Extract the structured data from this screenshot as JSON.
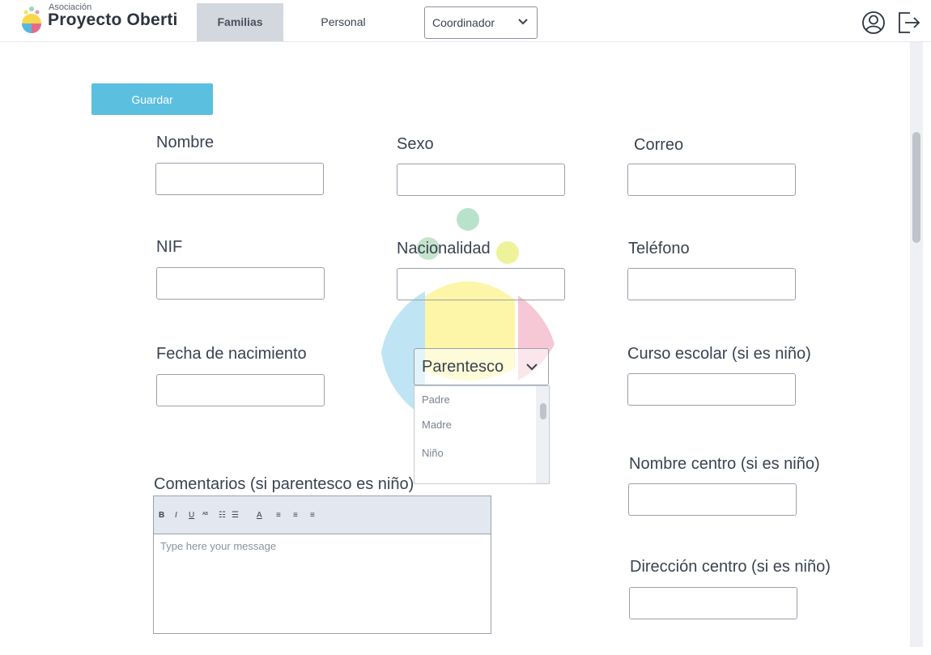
{
  "header": {
    "logo_small": "Asociación",
    "logo_big": "Proyecto Oberti",
    "tabs": [
      {
        "label": "Familias",
        "active": true
      },
      {
        "label": "Personal",
        "active": false
      }
    ],
    "role_select": {
      "value": "Coordinador"
    },
    "icons": {
      "user": "user-circle-icon",
      "logout": "logout-icon"
    }
  },
  "form": {
    "save_label": "Guardar",
    "fields": {
      "nombre": "Nombre",
      "sexo": "Sexo",
      "correo": "Correo",
      "nif": "NIF",
      "nacionalidad": "Nacionalidad",
      "telefono": "Teléfono",
      "fecha": "Fecha de nacimiento",
      "curso": "Curso escolar (si es niño)",
      "nombre_centro": "Nombre centro (si es niño)",
      "direccion_centro": "Dirección centro (si es niño)",
      "comentarios": "Comentarios (si parentesco es niño)"
    },
    "parentesco": {
      "placeholder": "Parentesco",
      "options": [
        "Padre",
        "Madre",
        "Niño"
      ]
    },
    "editor": {
      "placeholder": "Type here your message",
      "toolbar": [
        "B",
        "I",
        "U",
        "ᴬᴮ",
        "☷",
        "☰",
        "A",
        "≡",
        "≡",
        "≡"
      ]
    }
  },
  "colors": {
    "accent": "#5bbfe0",
    "active_tab": "#d3d7de",
    "toolbar_bg": "#e3e7ef"
  }
}
